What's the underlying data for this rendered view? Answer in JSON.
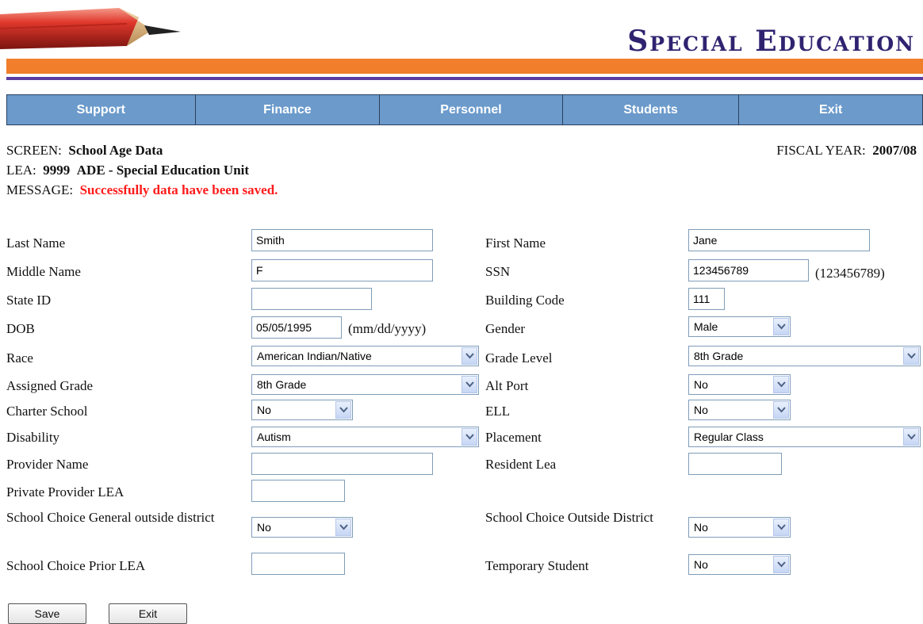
{
  "header": {
    "title": "Special Education",
    "logo_icon": "pencil-icon",
    "colors": {
      "title": "#2f2370",
      "stripe_orange": "#f07e2a",
      "stripe_purple": "#5a3fa0",
      "nav": "#6b9acb"
    }
  },
  "nav": {
    "support": "Support",
    "finance": "Finance",
    "personnel": "Personnel",
    "students": "Students",
    "exit": "Exit"
  },
  "info": {
    "screen_label": "SCREEN:",
    "screen_value": "School Age Data",
    "fiscal_label": "FISCAL YEAR:",
    "fiscal_value": "2007/08",
    "lea_label": "LEA:",
    "lea_code": "9999",
    "lea_name": "ADE - Special Education Unit",
    "message_label": "MESSAGE:",
    "message_value": "Successfully data have been saved.",
    "message_color": "#ff1a1a"
  },
  "form": {
    "last_name": {
      "label": "Last Name",
      "value": "Smith"
    },
    "first_name": {
      "label": "First Name",
      "value": "Jane"
    },
    "middle_name": {
      "label": "Middle Name",
      "value": "F"
    },
    "ssn": {
      "label": "SSN",
      "value": "123456789",
      "hint": "(123456789)"
    },
    "state_id": {
      "label": "State ID",
      "value": ""
    },
    "building_code": {
      "label": "Building Code",
      "value": "111"
    },
    "dob": {
      "label": "DOB",
      "value": "05/05/1995",
      "hint": "(mm/dd/yyyy)"
    },
    "gender": {
      "label": "Gender",
      "value": "Male"
    },
    "race": {
      "label": "Race",
      "value": "American Indian/Native"
    },
    "grade_level": {
      "label": "Grade Level",
      "value": "8th Grade"
    },
    "assigned_grade": {
      "label": "Assigned Grade",
      "value": "8th Grade"
    },
    "alt_port": {
      "label": "Alt Port",
      "value": "No"
    },
    "charter_school": {
      "label": "Charter School",
      "value": "No"
    },
    "ell": {
      "label": "ELL",
      "value": "No"
    },
    "disability": {
      "label": "Disability",
      "value": "Autism"
    },
    "placement": {
      "label": "Placement",
      "value": "Regular Class"
    },
    "provider_name": {
      "label": "Provider Name",
      "value": ""
    },
    "resident_lea": {
      "label": "Resident Lea",
      "value": ""
    },
    "private_provider_lea": {
      "label": "Private Provider LEA",
      "value": ""
    },
    "school_choice_general": {
      "label": "School Choice General outside district",
      "value": "No"
    },
    "school_choice_outside": {
      "label": "School Choice Outside District",
      "value": "No"
    },
    "school_choice_prior_lea": {
      "label": "School Choice Prior LEA",
      "value": ""
    },
    "temporary_student": {
      "label": "Temporary Student",
      "value": "No"
    }
  },
  "buttons": {
    "save": "Save",
    "exit": "Exit"
  }
}
